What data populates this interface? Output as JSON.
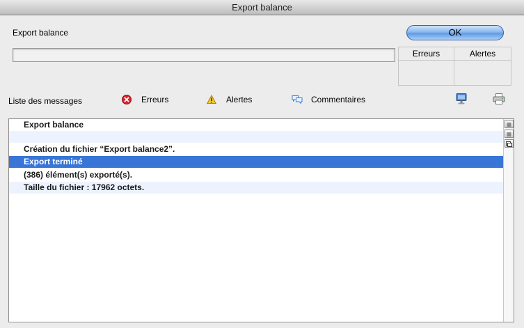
{
  "window": {
    "title": "Export balance"
  },
  "header": {
    "label": "Export balance",
    "ok_label": "OK"
  },
  "counts": {
    "errors_label": "Erreurs",
    "alerts_label": "Alertes"
  },
  "messages_bar": {
    "title": "Liste des messages",
    "filters": [
      {
        "label": "Erreurs",
        "icon": "error-icon"
      },
      {
        "label": "Alertes",
        "icon": "warning-icon"
      },
      {
        "label": "Commentaires",
        "icon": "comment-icon"
      }
    ],
    "tools": [
      {
        "icon": "screen-icon"
      },
      {
        "icon": "print-icon"
      }
    ]
  },
  "messages": [
    {
      "text": "Export balance",
      "state": "normal"
    },
    {
      "text": "",
      "state": "alt"
    },
    {
      "text": "Création du fichier “Export balance2”.",
      "state": "normal"
    },
    {
      "text": "Export terminé",
      "state": "selected"
    },
    {
      "text": "(386) élément(s) exporté(s).",
      "state": "normal"
    },
    {
      "text": "Taille du fichier : 17962 octets.",
      "state": "alt"
    }
  ],
  "colors": {
    "selection": "#3875d7",
    "alt_row": "#edf3fe",
    "ok_button": "#5f9ae5"
  }
}
